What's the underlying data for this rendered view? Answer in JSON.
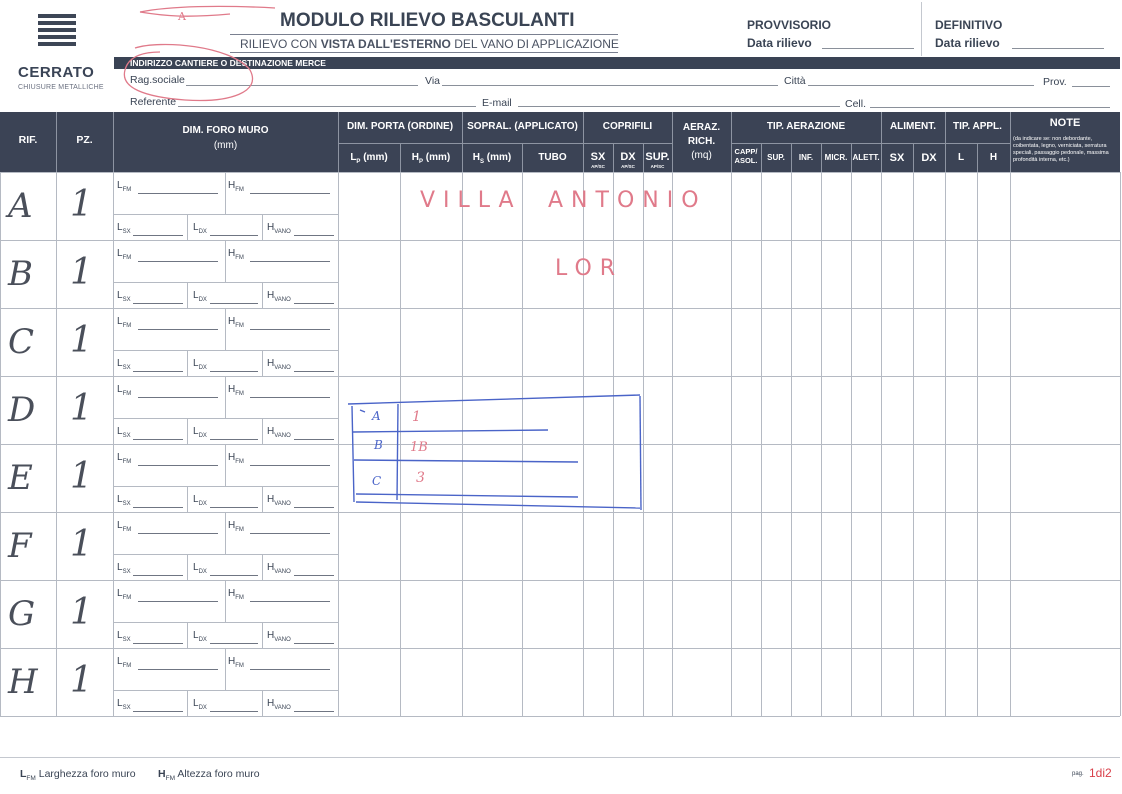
{
  "brand": {
    "name": "CERRATO",
    "tagline": "CHIUSURE METALLICHE"
  },
  "header": {
    "title": "MODULO RILIEVO BASCULANTI",
    "subtitle_pre": "RILIEVO CON ",
    "subtitle_bold": "VISTA DALL'ESTERNO",
    "subtitle_post": " DEL VANO DI APPLICAZIONE",
    "provvisorio": "PROVVISORIO",
    "definitivo": "DEFINITIVO",
    "data_rilievo": "Data rilievo"
  },
  "address": {
    "band": "INDIRIZZO CANTIERE O DESTINAZIONE MERCE",
    "rag_sociale": "Rag.sociale",
    "via": "Via",
    "citta": "Città",
    "prov": "Prov.",
    "referente": "Referente",
    "email": "E-mail",
    "cell": "Cell."
  },
  "table_header": {
    "rif": "RIF.",
    "pz": "PZ.",
    "dim_foro": "DIM. FORO MURO",
    "dim_foro_unit": "(mm)",
    "dim_porta": "DIM. PORTA (ORDINE)",
    "lp": "L",
    "lp_sub": "P",
    "lp_unit": " (mm)",
    "hp": "H",
    "hp_sub": "P",
    "hp_unit": " (mm)",
    "sopral": "SOPRAL. (APPLICATO)",
    "hs": "H",
    "hs_sub": "S",
    "hs_unit": " (mm)",
    "tubo": "TUBO",
    "coprifili": "COPRIFILI",
    "sx": "SX",
    "dx": "DX",
    "sup": "SUP.",
    "apsc": "AP/SC",
    "aeraz1": "AERAZ.",
    "aeraz2": "RICH.",
    "aeraz3": "(mq)",
    "tip_aerazione": "TIP. AERAZIONE",
    "capp1": "CAPP/",
    "capp2": "ASOL.",
    "sup2": "SUP.",
    "inf": "INF.",
    "micr": "MICR.",
    "alett": "ALETT.",
    "aliment": "ALIMENT.",
    "al_sx": "SX",
    "al_dx": "DX",
    "tip_appl": "TIP. APPL.",
    "l": "L",
    "h": "H",
    "note": "NOTE",
    "note_desc": "(da indicare se: non debordante, coibentata, legno, verniciata, serratura speciali, passaggio pedonale, massima profondità interna, etc.)"
  },
  "row_labels": {
    "l": "L",
    "fm": "FM",
    "h": "H",
    "sx": "SX",
    "dx": "DX",
    "vano": "VANO"
  },
  "rows": [
    {
      "rif": "A",
      "pz": "1"
    },
    {
      "rif": "B",
      "pz": "1"
    },
    {
      "rif": "C",
      "pz": "1"
    },
    {
      "rif": "D",
      "pz": "1"
    },
    {
      "rif": "E",
      "pz": "1"
    },
    {
      "rif": "F",
      "pz": "1"
    },
    {
      "rif": "G",
      "pz": "1"
    },
    {
      "rif": "H",
      "pz": "1"
    }
  ],
  "handwriting": {
    "villa": "VILLA",
    "antonio": "ANTONIO",
    "lor": "LOR",
    "top_mark": "A",
    "box_rows": [
      {
        "ref": "A",
        "val": "1"
      },
      {
        "ref": "B",
        "val": "1B"
      },
      {
        "ref": "C",
        "val": "3"
      }
    ]
  },
  "footer": {
    "lfm_letter": "L",
    "lfm_sub": "FM",
    "lfm_text": " Larghezza foro muro",
    "hfm_letter": "H",
    "hfm_sub": "FM",
    "hfm_text": " Altezza foro muro",
    "pag_label": "pag.",
    "pag_value": "1di2"
  },
  "colors": {
    "header_bg": "#3b4355",
    "ink_red": "#e07a8a",
    "ink_blue": "#4a64c8",
    "page_red": "#d9404a"
  }
}
